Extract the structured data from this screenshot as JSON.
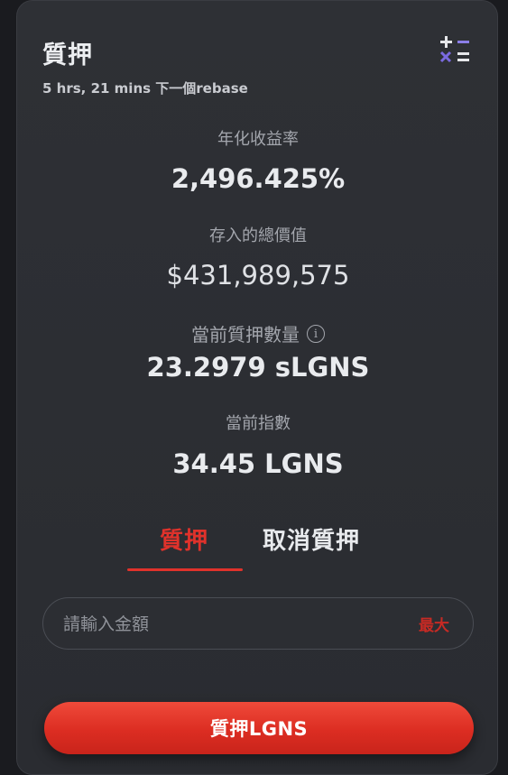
{
  "header": {
    "title": "質押",
    "rebase_countdown": "5 hrs, 21 mins 下一個rebase",
    "calculator_icon": "calculator-icon"
  },
  "stats": {
    "apy_label": "年化收益率",
    "apy_value": "2,496.425%",
    "tvl_label": "存入的總價值",
    "tvl_value": "$431,989,575",
    "staked_label": "當前質押數量",
    "staked_info_icon": "info-icon",
    "staked_value": "23.2979 sLGNS",
    "index_label": "當前指數",
    "index_value": "34.45 LGNS"
  },
  "tabs": {
    "stake_label": "質押",
    "unstake_label": "取消質押",
    "active": "stake"
  },
  "amount_input": {
    "value": "",
    "placeholder": "請輸入金額",
    "max_label": "最大"
  },
  "action": {
    "stake_button_label": "質押LGNS"
  },
  "colors": {
    "accent": "#e0322b",
    "card_background": "#2e3035",
    "page_background": "#1a1b1f",
    "calc_plus": "#e6e7ea",
    "calc_minus": "#8b7ee8",
    "calc_times": "#7b6ae0"
  }
}
